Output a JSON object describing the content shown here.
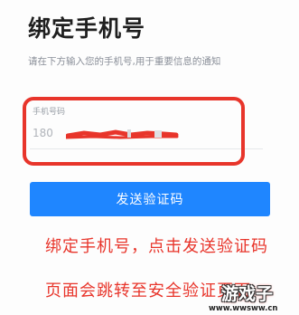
{
  "header": {
    "title": "绑定手机号",
    "subtitle": "请在下方输入您的手机号,用于重要信息的通知"
  },
  "phone_field": {
    "label": "手机号码",
    "value_prefix": "180"
  },
  "send_button": {
    "label": "发送验证码"
  },
  "annotation": {
    "line1": "绑定手机号，点击发送验证码",
    "line2": "页面会跳转至安全验证页面",
    "color": "#e8352b"
  },
  "watermark": {
    "mark": "游戏子",
    "url": "www.wwsww.cn"
  },
  "colors": {
    "accent": "#1f86ff",
    "highlight": "#e8352b"
  }
}
